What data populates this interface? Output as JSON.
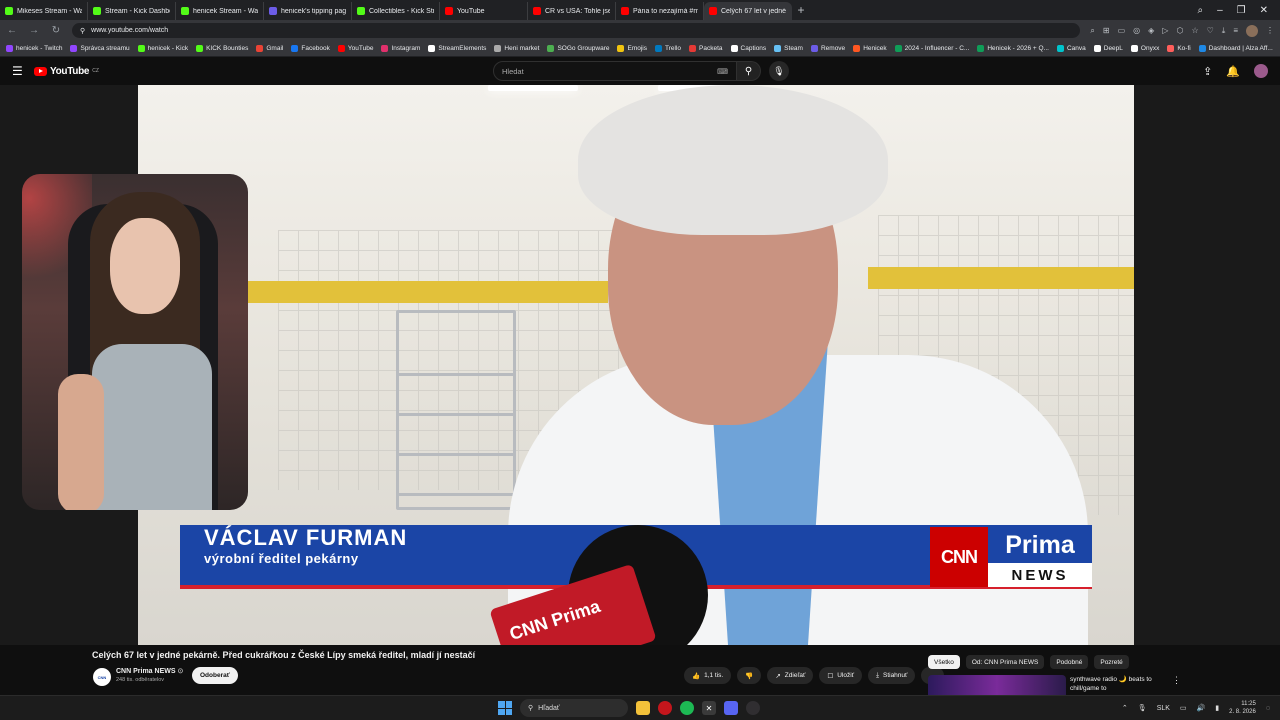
{
  "browser": {
    "tabs": [
      {
        "label": "Mikeses Stream - Wa",
        "color": "#53fc18",
        "active": false
      },
      {
        "label": "Stream - Kick Dashboard",
        "color": "#53fc18",
        "active": false
      },
      {
        "label": "henicek Stream - Watch L",
        "color": "#53fc18",
        "active": false
      },
      {
        "label": "henicek's tipping page",
        "color": "#6c5ce7",
        "active": false
      },
      {
        "label": "Collectibles - Kick Stream",
        "color": "#53fc18",
        "active": false
      },
      {
        "label": "YouTube",
        "color": "#ff0000",
        "active": false
      },
      {
        "label": "ČR vs USA: Tohle jsem v Č",
        "color": "#ff0000",
        "active": false
      },
      {
        "label": "Pána to nezajímá #mikes",
        "color": "#ff0000",
        "active": false
      },
      {
        "label": "Celých 67 let v jedné",
        "color": "#ff0000",
        "active": true
      }
    ],
    "new_tab": "+",
    "url": "www.youtube.com/watch",
    "bookmarks": [
      {
        "label": "henicek - Twitch",
        "color": "#9146ff"
      },
      {
        "label": "Správca streamu",
        "color": "#9146ff"
      },
      {
        "label": "henicek - Kick",
        "color": "#53fc18"
      },
      {
        "label": "KICK Bounties",
        "color": "#53fc18"
      },
      {
        "label": "Gmail",
        "color": "#ea4335"
      },
      {
        "label": "Facebook",
        "color": "#1877f2"
      },
      {
        "label": "YouTube",
        "color": "#ff0000"
      },
      {
        "label": "Instagram",
        "color": "#e1306c"
      },
      {
        "label": "StreamElements",
        "color": "#ffffff"
      },
      {
        "label": "Heni market",
        "color": "#aaaaaa"
      },
      {
        "label": "SOGo Groupware",
        "color": "#4caf50"
      },
      {
        "label": "Emojis",
        "color": "#f1c40f"
      },
      {
        "label": "Trello",
        "color": "#0079bf"
      },
      {
        "label": "Packeta",
        "color": "#e53935"
      },
      {
        "label": "Captions",
        "color": "#ffffff"
      },
      {
        "label": "Steam",
        "color": "#66c0f4"
      },
      {
        "label": "Remove",
        "color": "#6c5ce7"
      },
      {
        "label": "Henicek",
        "color": "#ff5722"
      },
      {
        "label": "2024 - Influencer - C...",
        "color": "#0f9d58"
      },
      {
        "label": "Henicek - 2026 + Q...",
        "color": "#0f9d58"
      },
      {
        "label": "Canva",
        "color": "#00c4cc"
      },
      {
        "label": "DeepL",
        "color": "#ffffff"
      },
      {
        "label": "Onyxx",
        "color": "#ffffff"
      },
      {
        "label": "Ko-fi",
        "color": "#ff5e5b"
      },
      {
        "label": "Dashboard | Alza Aff...",
        "color": "#1e88e5"
      },
      {
        "label": "eRank",
        "color": "#ffffff"
      },
      {
        "label": "Etsy",
        "color": "#f56400"
      }
    ]
  },
  "youtube": {
    "logo_text": "YouTube",
    "logo_cc": "CZ",
    "search_placeholder": "Hledat"
  },
  "video": {
    "lower_third_name": "VÁCLAV FURMAN",
    "lower_third_role": "výrobní ředitel pekárny",
    "logo_cnn": "CNN",
    "logo_prima": "Prima",
    "logo_news": "NEWS",
    "mic_label": "CNN Prima"
  },
  "details": {
    "title": "Celých 67 let v jedné pekárně. Před cukrářkou z České Lípy smeká ředitel, mladí jí nestačí",
    "channel_name": "CNN Prima NEWS",
    "channel_avatar_text": "CNN",
    "verified": "⊙",
    "subscribers": "248 tis. odběratelov",
    "subscribe_label": "Odoberať",
    "like_count": "1,1 tis.",
    "share_label": "Zdieľať",
    "save_label": "Uložiť",
    "download_label": "Stiahnuť",
    "more_label": "⋯"
  },
  "sidebar": {
    "chips": [
      {
        "label": "Všetko",
        "active": true
      },
      {
        "label": "Od: CNN Prima NEWS",
        "active": false
      },
      {
        "label": "Podobné",
        "active": false
      },
      {
        "label": "Pozreté",
        "active": false
      }
    ],
    "rec_title": "synthwave radio 🌙 beats to chill/game to"
  },
  "taskbar": {
    "search_label": "Hľadať",
    "lang": "SLK",
    "time": "11:25",
    "date": "2. 8. 2026"
  }
}
